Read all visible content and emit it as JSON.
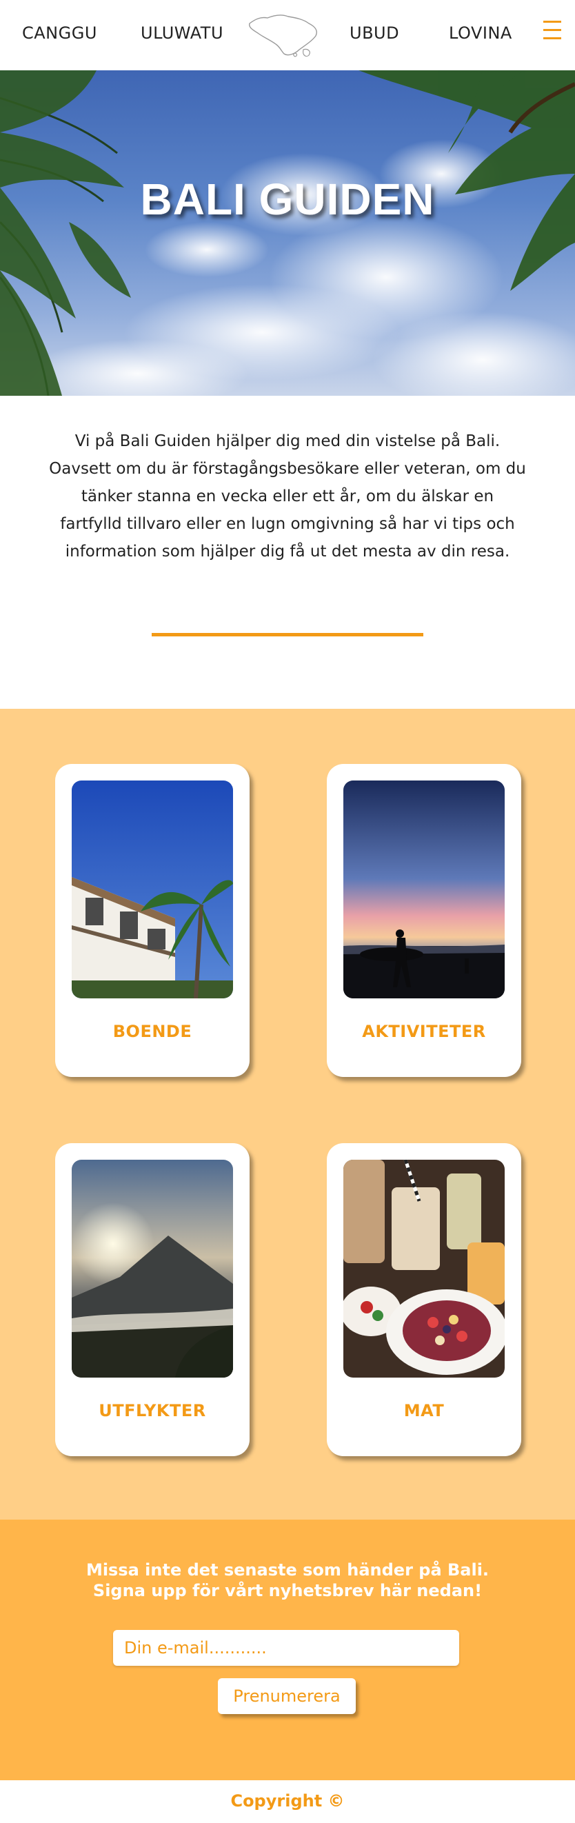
{
  "nav": {
    "links": [
      "CANGGU",
      "ULUWATU",
      "UBUD",
      "LOVINA"
    ],
    "logo_icon": "bali-island-map-icon",
    "menu_icon": "hamburger-menu-icon",
    "accent_color": "#f39a16"
  },
  "hero": {
    "title": "BALI GUIDEN",
    "image": "palm-trees-blue-sky"
  },
  "intro": {
    "text": "Vi på Bali Guiden hjälper dig med din vistelse på Bali. Oavsett om du är förstagångsbesökare eller veteran, om du tänker stanna en vecka eller ett år, om du älskar en fartfylld tillvaro eller en lugn omgivning så har vi tips och information som hjälper dig få ut det mesta av din resa."
  },
  "cards": [
    {
      "label": "BOENDE",
      "image": "villa-with-palm-tree"
    },
    {
      "label": "AKTIVITETER",
      "image": "surfer-at-sunset"
    },
    {
      "label": "UTFLYKTER",
      "image": "volcano-sunrise"
    },
    {
      "label": "MAT",
      "image": "smoothie-bowl-and-drinks"
    }
  ],
  "newsletter": {
    "line1": "Missa inte det senaste som händer på Bali.",
    "line2": "Signa upp för vårt nyhetsbrev här nedan!",
    "email_placeholder": "Din e-mail...........",
    "button_label": "Prenumerera"
  },
  "footer": {
    "copyright": "Copyright ©"
  },
  "colors": {
    "cards_bg": "#ffcf87",
    "newsletter_bg": "#ffb54a"
  }
}
